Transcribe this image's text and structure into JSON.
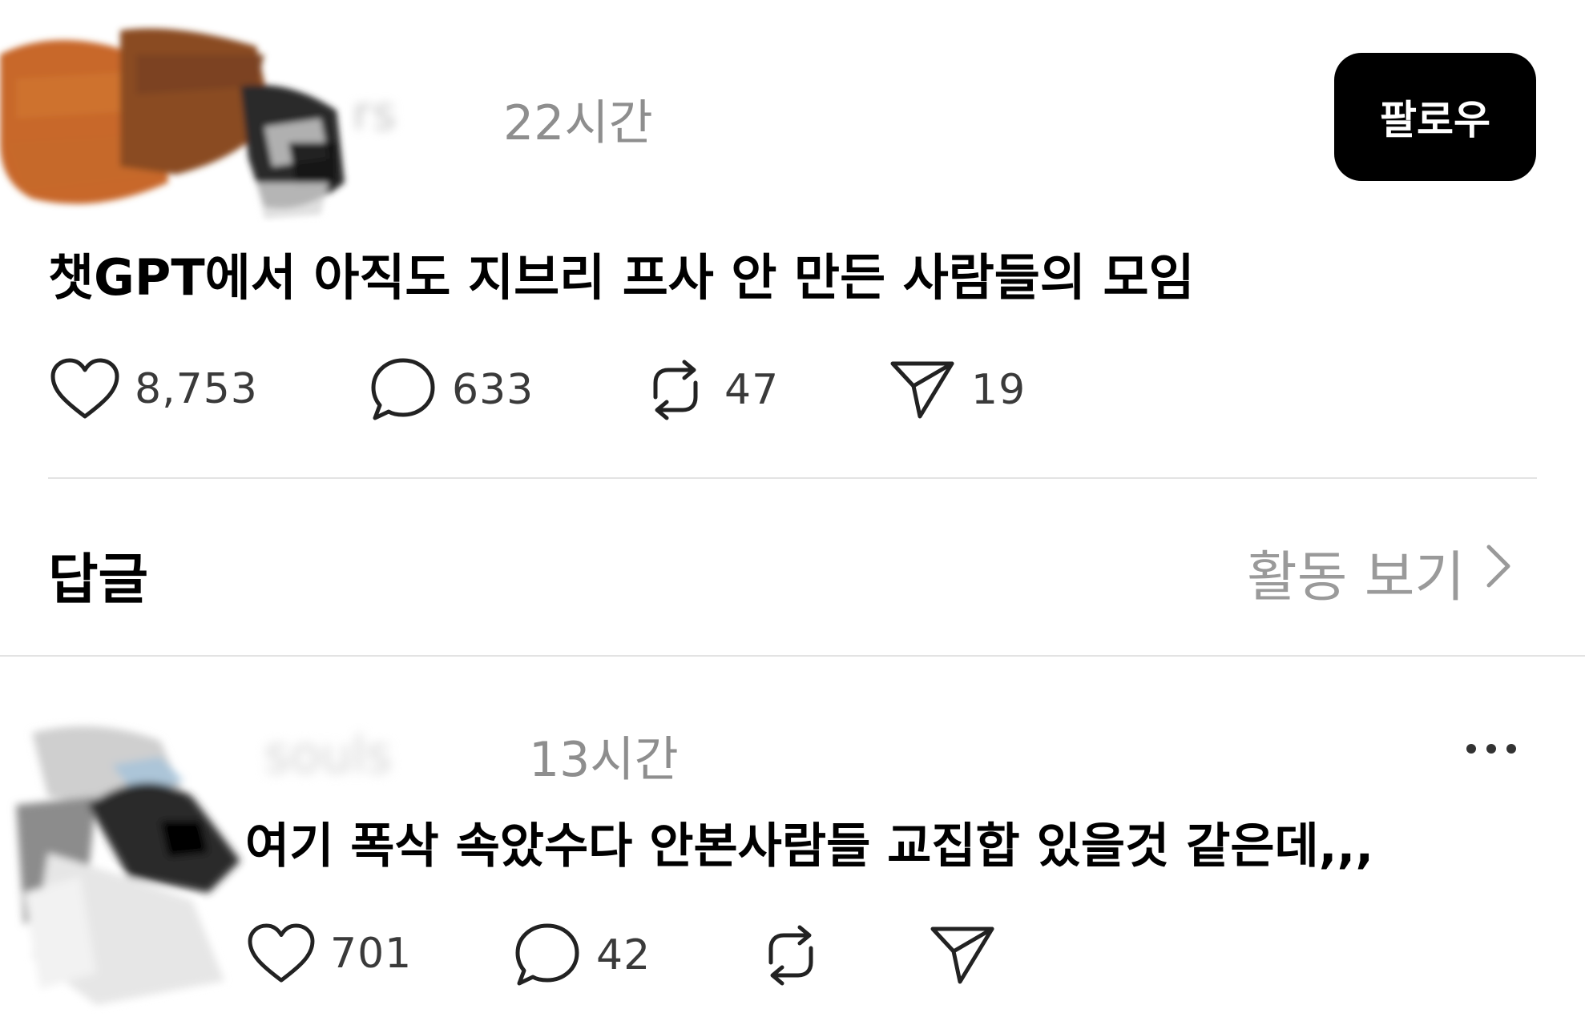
{
  "post": {
    "time": "22시간",
    "follow_label": "팔로우",
    "text": "챗GPT에서 아직도 지브리 프사 안 만든 사람들의 모임",
    "stats": {
      "likes": "8,753",
      "comments": "633",
      "reposts": "47",
      "shares": "19"
    }
  },
  "replies_section": {
    "heading": "답글",
    "view_activity": "활동 보기"
  },
  "reply": {
    "time": "13시간",
    "text": "여기 폭삭 속았수다 안본사람들 교집합 있을것 같은데,,,",
    "stats": {
      "likes": "701",
      "comments": "42"
    }
  },
  "icons": {
    "like": "heart-icon",
    "comment": "comment-bubble-icon",
    "repost": "repost-icon",
    "share": "send-icon",
    "more": "more-dots-icon",
    "chevron": "chevron-right-icon"
  },
  "colors": {
    "follow_button_bg": "#000000",
    "muted_text": "#8e8e8e",
    "divider": "#e3e3e3"
  }
}
